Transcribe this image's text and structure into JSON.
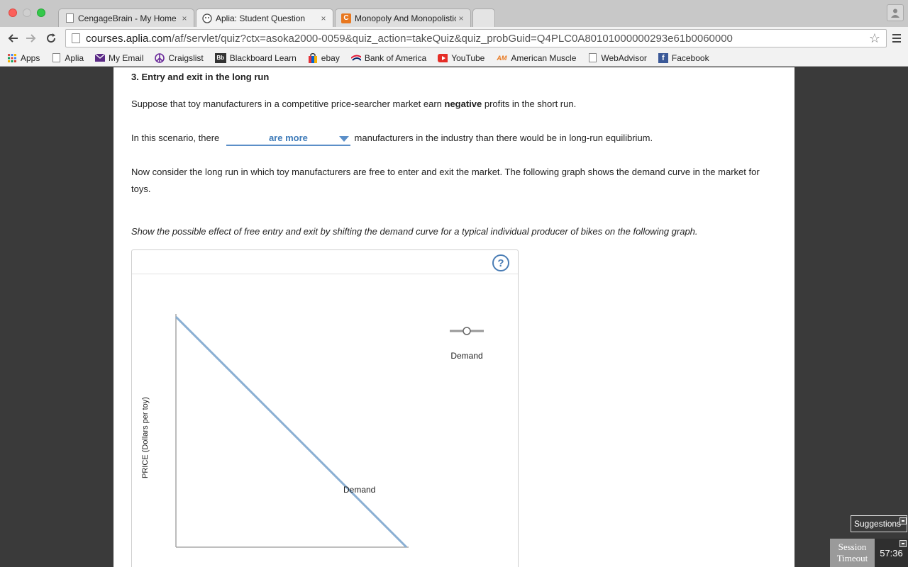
{
  "browser": {
    "tabs": [
      {
        "title": "CengageBrain - My Home",
        "icon": "page-icon",
        "close": "×"
      },
      {
        "title": "Aplia: Student Question",
        "icon": "aplia-icon",
        "close": "×"
      },
      {
        "title": "Monopoly And Monopolistic",
        "icon": "cengage-icon",
        "close": "×"
      }
    ],
    "url_host": "courses.aplia.com",
    "url_rest": "/af/servlet/quiz?ctx=asoka2000-0059&quiz_action=takeQuiz&quiz_probGuid=Q4PLC0A80101000000293e61b0060000",
    "bookmarks": [
      {
        "label": "Apps",
        "icon": "apps-grid-icon"
      },
      {
        "label": "Aplia",
        "icon": "page-icon"
      },
      {
        "label": "My Email",
        "icon": "mail-icon"
      },
      {
        "label": "Craigslist",
        "icon": "peace-icon"
      },
      {
        "label": "Blackboard Learn",
        "icon": "blackboard-icon"
      },
      {
        "label": "ebay",
        "icon": "shopping-bag-icon"
      },
      {
        "label": "Bank of America",
        "icon": "bank-flag-icon"
      },
      {
        "label": "YouTube",
        "icon": "youtube-icon"
      },
      {
        "label": "American Muscle",
        "icon": "am-logo-icon"
      },
      {
        "label": "WebAdvisor",
        "icon": "page-icon"
      },
      {
        "label": "Facebook",
        "icon": "facebook-icon"
      }
    ]
  },
  "question": {
    "title": "3. Entry and exit in the long run",
    "p1_before": "Suppose that toy manufacturers in a competitive price-searcher market earn ",
    "p1_bold": "negative",
    "p1_after": " profits in the short run.",
    "p2_before": "In this scenario, there",
    "p2_dropdown": "are more",
    "p2_after": "manufacturers in the industry than there would be in long-run equilibrium.",
    "p3": "Now consider the long run in which toy manufacturers are free to enter and exit the market. The following graph shows the demand curve in the market for toys.",
    "instruction": "Show the possible effect of free entry and exit by shifting the demand curve for a typical individual producer of bikes on the following graph."
  },
  "graph": {
    "help": "?",
    "ylabel": "PRICE (Dollars per toy)",
    "curve_label": "Demand",
    "legend_label": "Demand",
    "colors": {
      "demand": "#8aafd3",
      "axis": "#999999",
      "legend": "#999999"
    }
  },
  "widgets": {
    "suggestions": "Suggestions",
    "session_line1": "Session",
    "session_line2": "Timeout",
    "session_time": "57:36"
  }
}
